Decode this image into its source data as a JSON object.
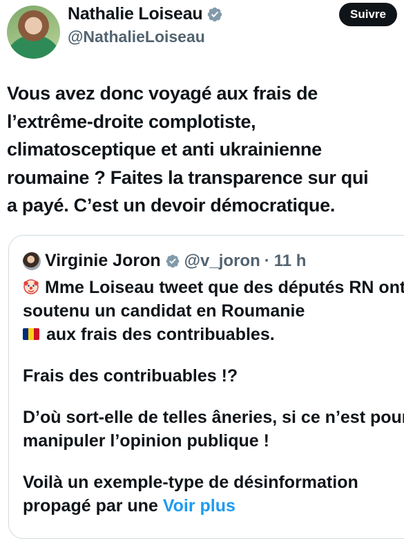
{
  "author": {
    "name": "Nathalie Loiseau",
    "handle": "@NathalieLoiseau"
  },
  "follow_button": "Suivre",
  "tweet_text": "Vous avez donc voyagé aux frais de\nl’extrême-droite complotiste,\nclimatosceptique et anti ukrainienne\nroumaine ? Faites la transparence sur qui\na payé. C’est un devoir démocratique.",
  "quote": {
    "author_name": "Virginie Joron",
    "handle": "@v_joron",
    "separator": "·",
    "time": "11 h",
    "line1": "Mme Loiseau tweet que des députés RN ont soutenu un candidat en Roumanie",
    "line2": "aux frais des contribuables.",
    "paragraph2": "Frais des contribuables !?",
    "paragraph3": "D’où sort-elle de telles âneries, si ce n’est pour manipuler l’opinion publique !",
    "paragraph4": "Voilà un exemple-type de désinformation",
    "paragraph4_cont": "propagé par une",
    "show_more": "Voir plus"
  },
  "colors": {
    "text": "#0f1419",
    "secondary": "#536471",
    "verified": "#829aab",
    "link": "#1d9bf0",
    "border": "#cfd9de"
  },
  "icons": {
    "verified": "verified-badge-icon",
    "clown": "clown-face-emoji",
    "flag": "romania-flag-emoji"
  }
}
